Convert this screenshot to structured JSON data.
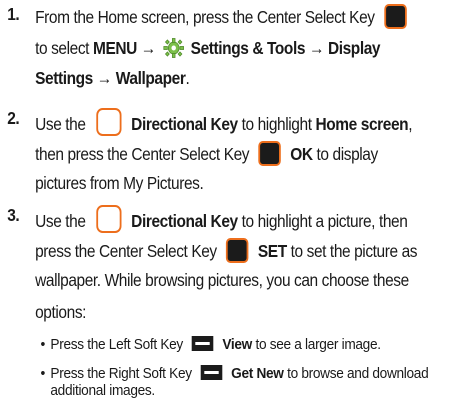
{
  "step1": {
    "number": "1.",
    "line1": "From the Home screen, press the Center Select Key",
    "line2_pre": "to select",
    "menu": "MENU",
    "arrow": "→",
    "settings_tools": "Settings & Tools",
    "display": "Display",
    "line3_settings": "Settings",
    "wallpaper": "Wallpaper",
    "period": "."
  },
  "step2": {
    "number": "2.",
    "use_the": "Use the",
    "directional_key": "Directional Key",
    "to_highlight": "to highlight",
    "home_screen": "Home screen",
    "comma": ",",
    "then_press": "then press the Center Select Key",
    "ok": "OK",
    "to_display": "to display",
    "line3": "pictures from My Pictures."
  },
  "step3": {
    "number": "3.",
    "use_the": "Use the",
    "directional_key": "Directional Key",
    "to_highlight_picture": "to highlight a picture, then",
    "press_center": "press the Center Select Key",
    "set": "SET",
    "set_as": "to set the picture as",
    "line3": "wallpaper.  While browsing pictures, you can choose these",
    "line4": "options:"
  },
  "bullets": [
    {
      "bullet": "•",
      "pre": "Press the Left Soft Key",
      "key": "View",
      "post": "to see a larger image."
    },
    {
      "bullet": "•",
      "pre": "Press the Right Soft Key",
      "key": "Get New",
      "post": "to browse and download",
      "line2": "additional images."
    }
  ],
  "icons": {
    "center_select_key": "center-select-key-icon",
    "directional_key": "directional-key-icon",
    "settings_gear": "settings-gear-icon",
    "soft_key": "soft-key-icon"
  },
  "colors": {
    "key_outline": "#ed6e1c",
    "key_fill": "#1b1b1b",
    "gear_green": "#7cc04a"
  }
}
